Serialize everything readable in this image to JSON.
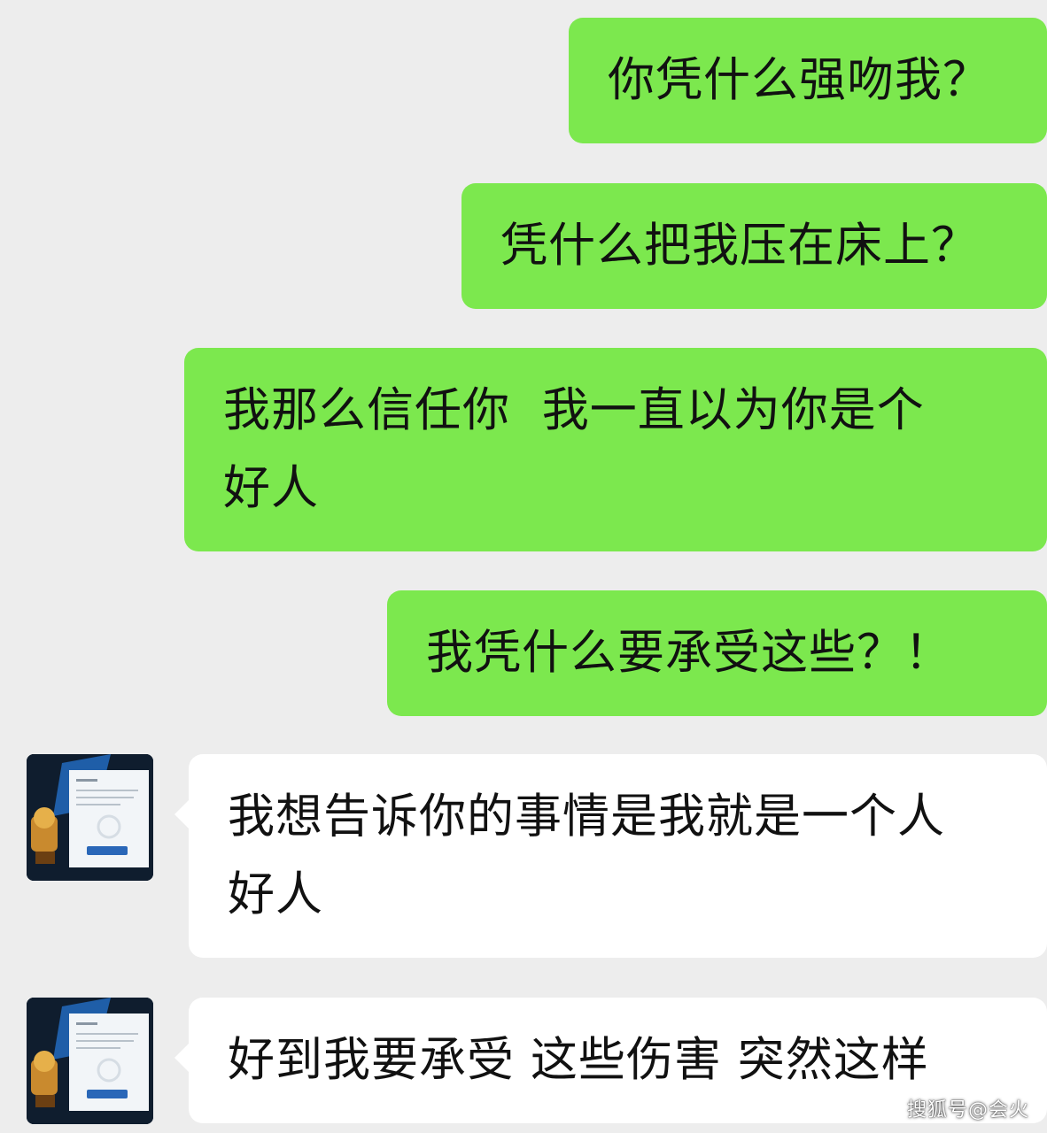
{
  "chat": {
    "messages": [
      {
        "side": "sent",
        "text": "你凭什么强吻我？"
      },
      {
        "side": "sent",
        "text": "凭什么把我压在床上？"
      },
      {
        "side": "sent",
        "text": "我那么信任你  我一直以为你是个\n好人"
      },
      {
        "side": "sent",
        "text": "我凭什么要承受这些？！"
      },
      {
        "side": "received",
        "text": "我想告诉你的事情是我就是一个人\n好人",
        "avatar": "avatar-certificate-trophy-image"
      },
      {
        "side": "received",
        "text": "好到我要承受 这些伤害 突然这样",
        "avatar": "avatar-certificate-trophy-image"
      }
    ]
  },
  "watermark": "搜狐号@会火",
  "colors": {
    "background": "#ededed",
    "sent_bubble": "#7ce84e",
    "received_bubble": "#ffffff",
    "text": "#111111"
  }
}
